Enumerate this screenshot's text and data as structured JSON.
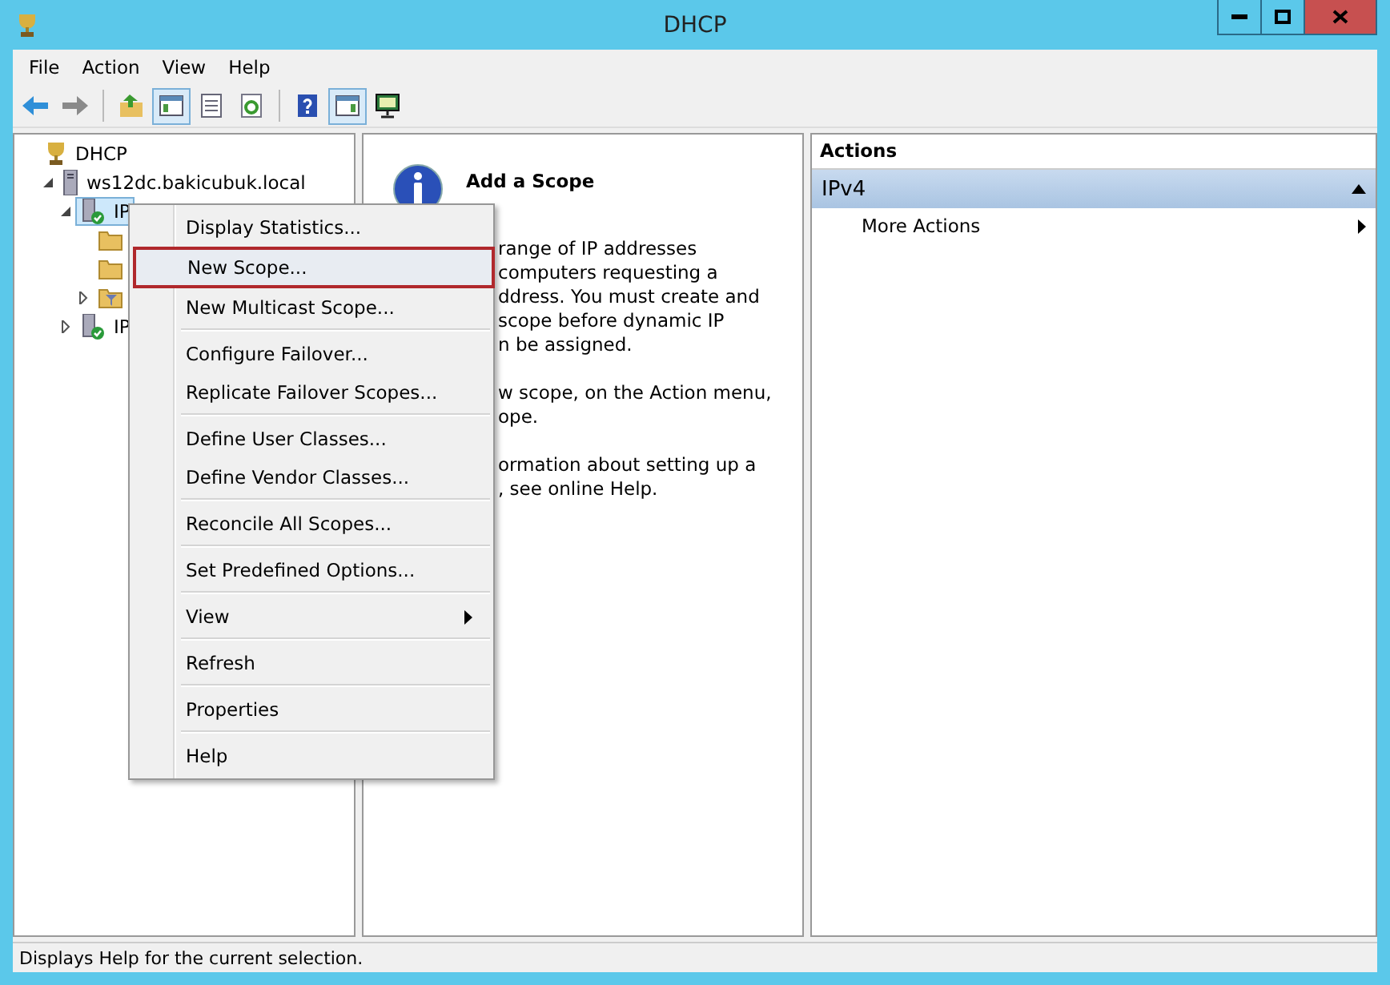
{
  "window": {
    "title": "DHCP"
  },
  "menu_bar": [
    "File",
    "Action",
    "View",
    "Help"
  ],
  "toolbar": [
    {
      "kind": "back",
      "pressed": false
    },
    {
      "kind": "forward",
      "pressed": false
    },
    {
      "kind": "sep"
    },
    {
      "kind": "up",
      "pressed": false
    },
    {
      "kind": "tree",
      "pressed": true
    },
    {
      "kind": "list",
      "pressed": false
    },
    {
      "kind": "refresh",
      "pressed": false
    },
    {
      "kind": "sep"
    },
    {
      "kind": "help",
      "pressed": false
    },
    {
      "kind": "pane",
      "pressed": true
    },
    {
      "kind": "monitor",
      "pressed": false
    }
  ],
  "tree": [
    {
      "label": "DHCP",
      "kind": "root",
      "selected": false,
      "children": [
        {
          "label": "ws12dc.bakicubuk.local",
          "kind": "server",
          "expanded": true,
          "selected": false,
          "children": [
            {
              "label": "IP",
              "kind": "scope-server",
              "expanded": true,
              "selected": true,
              "children": [
                {
                  "kind": "folder",
                  "selected": false
                },
                {
                  "kind": "folder",
                  "selected": false
                },
                {
                  "kind": "filter-folder",
                  "expanded": false,
                  "selected": false
                }
              ]
            },
            {
              "label": "IP",
              "kind": "scope-server",
              "expanded": false,
              "selected": false
            }
          ]
        }
      ]
    }
  ],
  "info": {
    "title": "Add a Scope",
    "paragraphs": [
      [
        "range of IP addresses",
        "computers requesting a",
        "ddress. You must create and",
        "scope before dynamic IP",
        "n be assigned."
      ],
      [
        "w scope, on the Action menu,",
        "ope."
      ],
      [
        "ormation about setting up a",
        ", see online Help."
      ]
    ]
  },
  "actions": {
    "header": "Actions",
    "sections": [
      {
        "title": "IPv4",
        "expanded": true,
        "items": [
          {
            "label": "More Actions",
            "submenu": true
          }
        ]
      }
    ]
  },
  "context_menu": [
    [
      {
        "label": "Display Statistics...",
        "selected": false,
        "submenu": false
      },
      {
        "label": "New Scope...",
        "selected": true,
        "submenu": false
      },
      {
        "label": "New Multicast Scope...",
        "selected": false,
        "submenu": false
      }
    ],
    [
      {
        "label": "Configure Failover...",
        "selected": false,
        "submenu": false
      },
      {
        "label": "Replicate Failover Scopes...",
        "selected": false,
        "submenu": false
      }
    ],
    [
      {
        "label": "Define User Classes...",
        "selected": false,
        "submenu": false
      },
      {
        "label": "Define Vendor Classes...",
        "selected": false,
        "submenu": false
      }
    ],
    [
      {
        "label": "Reconcile All Scopes...",
        "selected": false,
        "submenu": false
      }
    ],
    [
      {
        "label": "Set Predefined Options...",
        "selected": false,
        "submenu": false
      }
    ],
    [
      {
        "label": "View",
        "selected": false,
        "submenu": true
      }
    ],
    [
      {
        "label": "Refresh",
        "selected": false,
        "submenu": false
      }
    ],
    [
      {
        "label": "Properties",
        "selected": false,
        "submenu": false
      }
    ],
    [
      {
        "label": "Help",
        "selected": false,
        "submenu": false
      }
    ]
  ],
  "status_bar": "Displays Help for the current selection."
}
